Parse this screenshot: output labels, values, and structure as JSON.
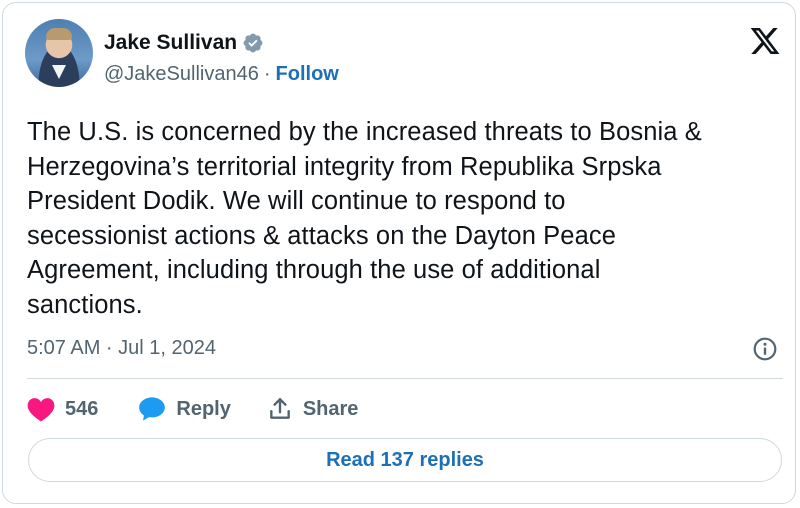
{
  "author": {
    "display_name": "Jake Sullivan",
    "handle": "@JakeSullivan46",
    "separator": "·",
    "follow_label": "Follow",
    "verified": true,
    "verified_color": "#829aab"
  },
  "platform": {
    "logo_icon": "x-logo-icon"
  },
  "tweet": {
    "text": "The U.S. is concerned by the increased threats to Bosnia &\nHerzegovina’s territorial integrity from Republika Srpska\nPresident Dodik. We will continue to respond to\nsecessionist actions & attacks on the Dayton Peace\nAgreement, including through the use of additional\nsanctions.",
    "timestamp": "5:07 AM · Jul 1, 2024",
    "info_icon": "info-icon"
  },
  "actions": {
    "like_count": "546",
    "like_icon": "heart-icon",
    "like_color": "#f91880",
    "reply_label": "Reply",
    "reply_icon": "speech-bubble-icon",
    "reply_icon_color": "#1d9bf0",
    "share_label": "Share",
    "share_icon": "share-icon"
  },
  "replies_button": {
    "label": "Read 137 replies"
  },
  "colors": {
    "link": "#1d6fb8",
    "secondary_text": "#536471",
    "border": "#cfd9de"
  }
}
